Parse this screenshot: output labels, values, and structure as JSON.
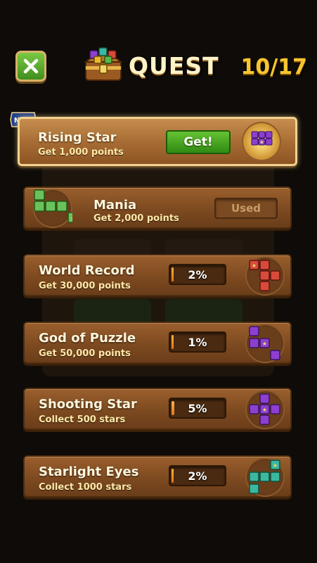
{
  "header": {
    "title": "QUEST",
    "counter": "10/17",
    "close_icon": "close-x-icon",
    "chest_icon": "treasure-chest-icon"
  },
  "new_badge": "NEW",
  "quests": [
    {
      "name": "Rising Star",
      "desc": "Get 1,000 points",
      "state": "claimable",
      "button": "Get!",
      "icon": "purple-star-block-icon"
    },
    {
      "name": "Mania",
      "desc": "Get 2,000 points",
      "state": "used",
      "button": "Used",
      "icon": "green-block-icon"
    },
    {
      "name": "World Record",
      "desc": "Get 30,000 points",
      "state": "progress",
      "progress_label": "2%",
      "progress": 0.02,
      "icon": "red-block-icon"
    },
    {
      "name": "God of Puzzle",
      "desc": "Get 50,000 points",
      "state": "progress",
      "progress_label": "1%",
      "progress": 0.01,
      "icon": "purple-block-icon"
    },
    {
      "name": "Shooting Star",
      "desc": "Collect 500 stars",
      "state": "progress",
      "progress_label": "5%",
      "progress": 0.05,
      "icon": "purple-plus-block-icon"
    },
    {
      "name": "Starlight Eyes",
      "desc": "Collect 1000 stars",
      "state": "progress",
      "progress_label": "2%",
      "progress": 0.02,
      "icon": "teal-block-icon"
    }
  ],
  "colors": {
    "accent_gold": "#f7c531",
    "card_wood": "#8a5426",
    "get_green": "#4caf2a",
    "progress_orange": "#f0902c"
  }
}
